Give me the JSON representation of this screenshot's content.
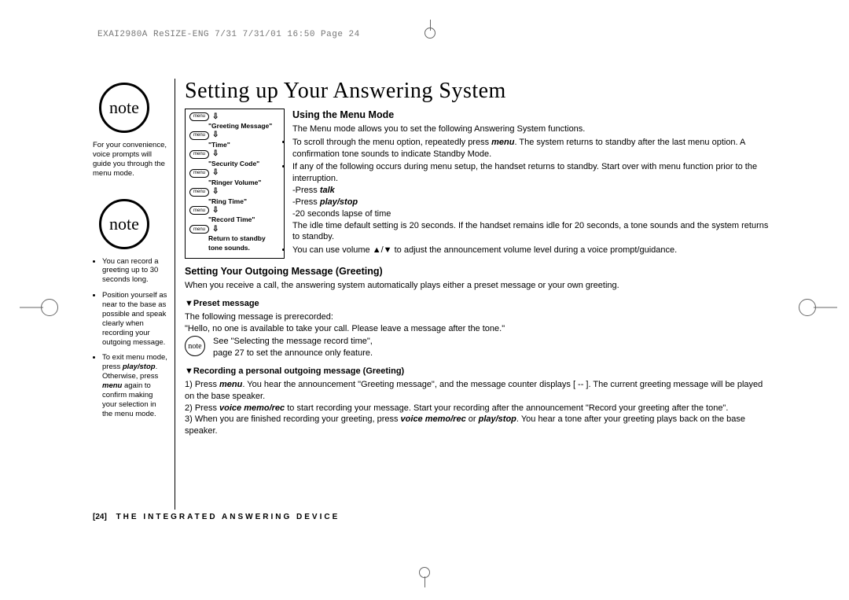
{
  "meta_header": "EXAI2980A ReSIZE-ENG 7/31  7/31/01  16:50  Page 24",
  "side": {
    "note_label": "note",
    "note1_text": "For your convenience, voice prompts will guide you through the menu mode.",
    "note2_items": [
      "You can record a greeting up to 30 seconds long.",
      "Position yourself as near to the base as possible and speak clearly when recording your outgoing message."
    ],
    "note2_last_prefix": "To exit menu mode, press ",
    "note2_last_bold1": "play/stop",
    "note2_last_mid": ". Otherwise, press ",
    "note2_last_bold2": "menu",
    "note2_last_suffix": " again to confirm making your selection in the menu mode."
  },
  "menu_flow": {
    "button_label": "menu",
    "items": [
      "\"Greeting Message\"",
      "\"Time\"",
      "\"Security Code\"",
      "\"Ringer Volume\"",
      "\"Ring Time\"",
      "\"Record Time\""
    ],
    "final": "Return to standby tone sounds."
  },
  "main": {
    "title": "Setting up Your Answering System",
    "using_heading": "Using the Menu Mode",
    "using_intro": "The Menu mode allows you to set the following Answering System functions.",
    "b1_a": "To scroll through the menu option, repeatedly press ",
    "b1_menu": "menu",
    "b1_b": ". The system returns to standby after the last menu option. A confirmation tone sounds to indicate Standby Mode.",
    "b2": "If any of the following occurs during menu setup, the handset returns to standby. Start over with menu function prior to the interruption.",
    "b2_l1a": "-Press ",
    "b2_l1b": "talk",
    "b2_l2a": "-Press ",
    "b2_l2b": "play/stop",
    "b2_l3": "-20 seconds lapse of time",
    "b2_idle": "The idle time default setting is 20 seconds. If the handset remains idle for 20 seconds, a tone sounds and the system returns to standby.",
    "b3": "You can use volume ▲/▼ to adjust the announcement volume level during a voice prompt/guidance.",
    "setting_heading": "Setting Your Outgoing Message (Greeting)",
    "setting_intro": "When you receive a call, the answering system automatically plays either a preset message or your own greeting.",
    "preset_heading": "▼Preset message",
    "preset_l1": "The following message is prerecorded:",
    "preset_l2": "\"Hello, no one is available to take your call. Please leave a message after the tone.\"",
    "preset_note_l1": "See \"Selecting the message record time\",",
    "preset_note_l2": "page 27 to set the announce only feature.",
    "rec_heading": "▼Recording a personal outgoing message (Greeting)",
    "rec_s1a": "1) Press ",
    "rec_s1_menu": "menu",
    "rec_s1b": ". You hear the announcement \"Greeting message\", and the message counter displays [ -- ]. The current greeting message will be played on the base speaker.",
    "rec_s2a": "2) Press ",
    "rec_s2_vm": "voice memo/rec",
    "rec_s2b": " to start recording your message. Start your recording after the announcement \"Record your greeting after the tone\".",
    "rec_s3a": "3) When you are finished recording your greeting, press ",
    "rec_s3_vm": "voice memo/rec",
    "rec_s3_or": " or ",
    "rec_s3_ps": "play/stop",
    "rec_s3b": ". You hear a tone after your greeting plays back on the base speaker."
  },
  "footer": {
    "page_num": "[24]",
    "title": "THE INTEGRATED ANSWERING DEVICE"
  }
}
